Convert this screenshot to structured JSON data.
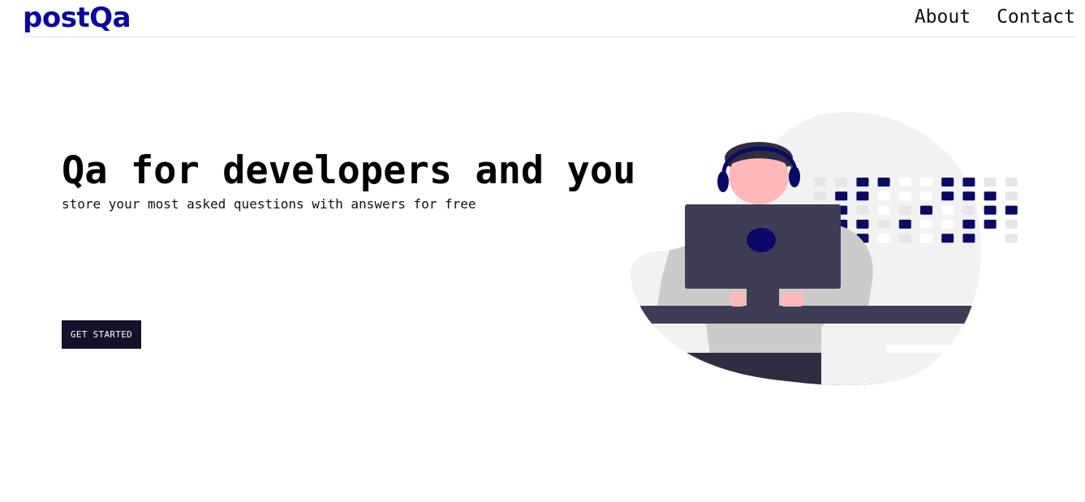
{
  "navbar": {
    "brand": "postQa",
    "links": [
      "About",
      "Contact"
    ]
  },
  "hero": {
    "title": "Qa for developers and you",
    "subtitle": "store your most asked questions with answers for free",
    "cta_label": "GET STARTED"
  },
  "illustration": {
    "description_icon": "developer-at-computer-illustration",
    "colors": {
      "accent": "#0a0868",
      "monitor": "#3f3d56",
      "skin": "#ffb8b8",
      "blob": "#f2f2f2",
      "grid_light": "#e6e6e6"
    }
  },
  "colors": {
    "brand": "#0a08a0",
    "button_bg": "#13122a",
    "text": "#000000"
  }
}
